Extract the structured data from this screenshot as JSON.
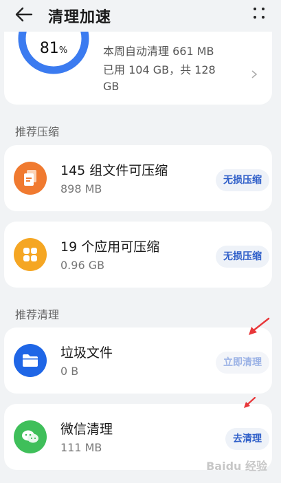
{
  "header": {
    "title": "清理加速"
  },
  "summary": {
    "percent": "81",
    "percent_unit": "%",
    "progress": 0.81,
    "line1": "本周自动清理 661 MB",
    "line2": "已用 104 GB，共 128",
    "line3": "GB"
  },
  "sections": {
    "compress": "推荐压缩",
    "clean": "推荐清理"
  },
  "items": [
    {
      "title": "145 组文件可压缩",
      "sub": "898 MB",
      "action": "无损压缩",
      "icon": "document-stack-icon"
    },
    {
      "title": "19 个应用可压缩",
      "sub": "0.96 GB",
      "action": "无损压缩",
      "icon": "app-grid-icon"
    },
    {
      "title": "垃圾文件",
      "sub": "0 B",
      "action": "立即清理",
      "icon": "folder-icon"
    },
    {
      "title": "微信清理",
      "sub": "111 MB",
      "action": "去清理",
      "icon": "wechat-icon"
    }
  ],
  "colors": {
    "accent": "#2f5fc9",
    "gauge": "#3b7bf0",
    "orange": "#f07a30",
    "yellow": "#f5a623",
    "blue": "#1f66e6",
    "green": "#3fbf5a",
    "annotation": "#e8373a"
  },
  "watermark": "Baidu 经验"
}
